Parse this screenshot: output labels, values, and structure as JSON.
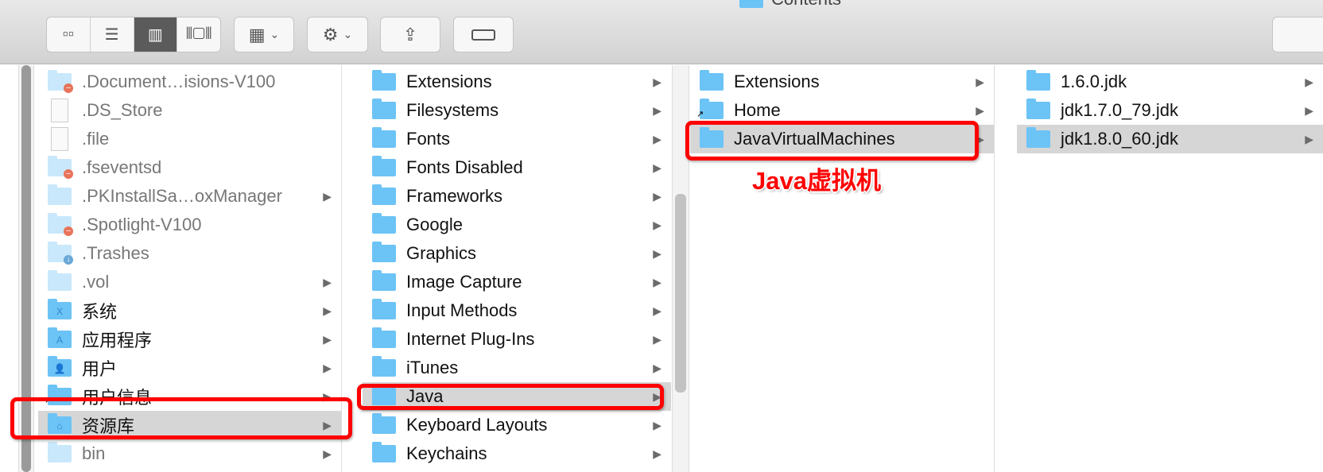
{
  "toolbar": {
    "path_item": "Contents",
    "view_modes": [
      "icon-view",
      "list-view",
      "column-view",
      "cover-flow-view"
    ],
    "active_view": "column-view"
  },
  "columns": [
    {
      "items": [
        {
          "label": ".Document…isions-V100",
          "icon": "folder",
          "badge": "minus",
          "hidden": true,
          "arrow": false
        },
        {
          "label": ".DS_Store",
          "icon": "file",
          "hidden": true,
          "arrow": false
        },
        {
          "label": ".file",
          "icon": "file",
          "hidden": true,
          "arrow": false
        },
        {
          "label": ".fseventsd",
          "icon": "folder",
          "badge": "minus",
          "hidden": true,
          "arrow": false
        },
        {
          "label": ".PKInstallSa…oxManager",
          "icon": "folder",
          "hidden": true,
          "arrow": true
        },
        {
          "label": ".Spotlight-V100",
          "icon": "folder",
          "badge": "minus",
          "hidden": true,
          "arrow": false
        },
        {
          "label": ".Trashes",
          "icon": "folder",
          "badge": "download",
          "hidden": true,
          "arrow": false
        },
        {
          "label": ".vol",
          "icon": "folder",
          "hidden": true,
          "arrow": true
        },
        {
          "label": "系统",
          "icon": "system-folder",
          "glyph": "X",
          "arrow": true
        },
        {
          "label": "应用程序",
          "icon": "applications-folder",
          "glyph": "A",
          "arrow": true
        },
        {
          "label": "用户",
          "icon": "users-folder",
          "glyph": "👤",
          "arrow": true
        },
        {
          "label": "用户信息",
          "icon": "folder-alias",
          "arrow": true
        },
        {
          "label": "资源库",
          "icon": "library-folder",
          "glyph": "⌂",
          "arrow": true,
          "selected": true
        },
        {
          "label": "bin",
          "icon": "folder",
          "hidden": true,
          "arrow": true
        }
      ]
    },
    {
      "items": [
        {
          "label": "Extensions"
        },
        {
          "label": "Filesystems"
        },
        {
          "label": "Fonts"
        },
        {
          "label": "Fonts Disabled"
        },
        {
          "label": "Frameworks"
        },
        {
          "label": "Google"
        },
        {
          "label": "Graphics"
        },
        {
          "label": "Image Capture"
        },
        {
          "label": "Input Methods"
        },
        {
          "label": "Internet Plug-Ins"
        },
        {
          "label": "iTunes"
        },
        {
          "label": "Java",
          "selected": true
        },
        {
          "label": "Keyboard Layouts"
        },
        {
          "label": "Keychains"
        }
      ]
    },
    {
      "items": [
        {
          "label": "Extensions"
        },
        {
          "label": "Home",
          "alias": true
        },
        {
          "label": "JavaVirtualMachines",
          "selected": true
        }
      ]
    },
    {
      "items": [
        {
          "label": "1.6.0.jdk"
        },
        {
          "label": "jdk1.7.0_79.jdk"
        },
        {
          "label": "jdk1.8.0_60.jdk",
          "selected": true
        }
      ]
    }
  ],
  "annotation": {
    "text": "Java虚拟机",
    "color": "#ff0000"
  }
}
